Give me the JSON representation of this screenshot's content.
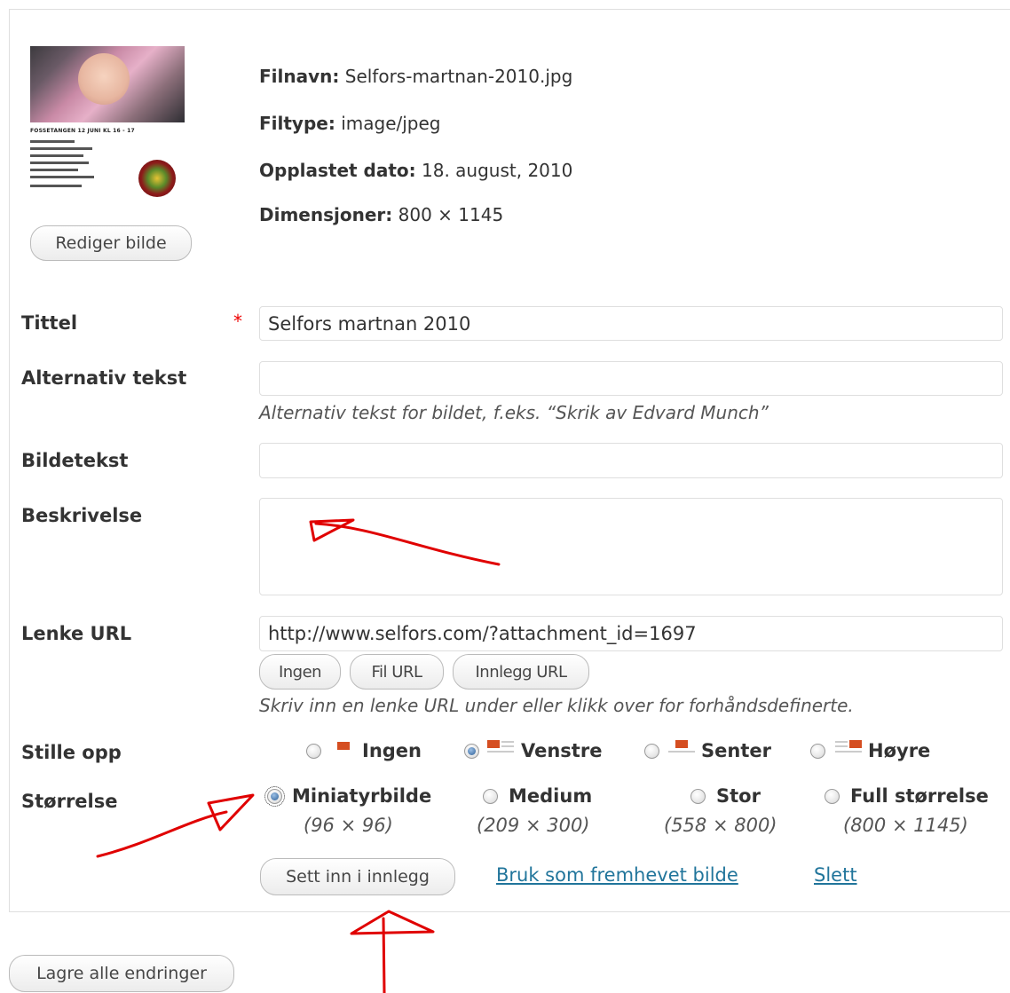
{
  "file": {
    "name_label": "Filnavn:",
    "name": "Selfors-martnan-2010.jpg",
    "type_label": "Filtype:",
    "type": "image/jpeg",
    "uploaded_label": "Opplastet dato:",
    "uploaded": "18. august, 2010",
    "dims_label": "Dimensjoner:",
    "dims": "800 × 1145",
    "thumb_headline": "FOSSETANGEN 12 JUNI KL 16 - 17"
  },
  "edit_image_button": "Rediger bilde",
  "fields": {
    "title_label": "Tittel",
    "required_mark": "*",
    "title_value": "Selfors martnan 2010",
    "alt_label": "Alternativ tekst",
    "alt_value": "",
    "alt_hint": "Alternativ tekst for bildet, f.eks. “Skrik av Edvard Munch”",
    "caption_label": "Bildetekst",
    "caption_value": "",
    "description_label": "Beskrivelse",
    "description_value": "",
    "link_label": "Lenke URL",
    "link_value": "http://www.selfors.com/?attachment_id=1697",
    "link_buttons": [
      "Ingen",
      "Fil URL",
      "Innlegg URL"
    ],
    "link_hint": "Skriv inn en lenke URL under eller klikk over for forhåndsdefinerte."
  },
  "alignment": {
    "label": "Stille opp",
    "options": [
      "Ingen",
      "Venstre",
      "Senter",
      "Høyre"
    ],
    "selected": "Venstre"
  },
  "size": {
    "label": "Størrelse",
    "options": [
      {
        "label": "Miniatyrbilde",
        "dims": "(96 × 96)"
      },
      {
        "label": "Medium",
        "dims": "(209 × 300)"
      },
      {
        "label": "Stor",
        "dims": "(558 × 800)"
      },
      {
        "label": "Full størrelse",
        "dims": "(800 × 1145)"
      }
    ],
    "selected": "Miniatyrbilde"
  },
  "actions": {
    "insert": "Sett inn i innlegg",
    "featured": "Bruk som fremhevet bilde",
    "delete": "Slett"
  },
  "save_all_button": "Lagre alle endringer",
  "colors": {
    "accent_link": "#21759b",
    "required": "#ee0000",
    "annotation": "#e00000",
    "align_icon": "#d54e21"
  }
}
